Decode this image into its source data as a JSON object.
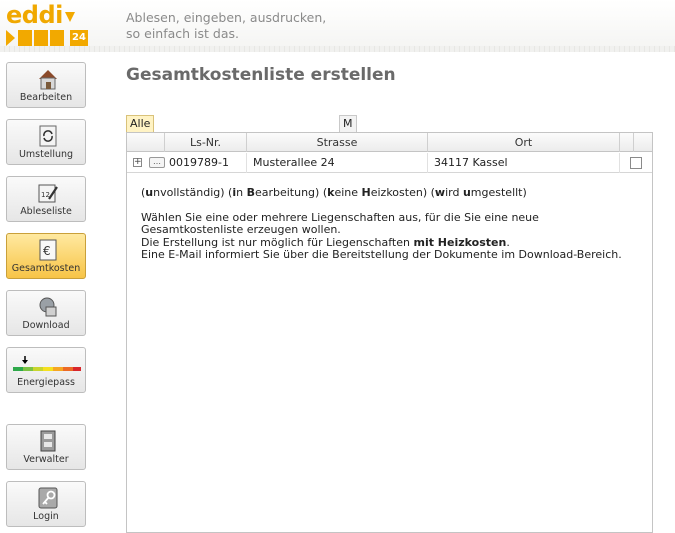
{
  "header": {
    "logo_text": "eddi",
    "logo_number": "24",
    "tagline_line1": "Ablesen, eingeben, ausdrucken,",
    "tagline_line2": "so einfach ist das."
  },
  "sidebar": {
    "items": [
      {
        "label": "Bearbeiten",
        "icon": "house-icon"
      },
      {
        "label": "Umstellung",
        "icon": "refresh-icon"
      },
      {
        "label": "Ableseliste",
        "icon": "calendar-pen-icon"
      },
      {
        "label": "Gesamtkosten",
        "icon": "euro-icon"
      },
      {
        "label": "Download",
        "icon": "download-icon"
      },
      {
        "label": "Energiepass",
        "icon": "energy-scale-icon"
      },
      {
        "label": "Verwalter",
        "icon": "cabinet-icon"
      },
      {
        "label": "Login",
        "icon": "key-icon"
      }
    ],
    "active": "Gesamtkosten"
  },
  "main": {
    "title": "Gesamtkostenliste erstellen",
    "filters": {
      "all": "Alle",
      "m": "M"
    },
    "columns": [
      "Ls-Nr.",
      "Strasse",
      "Ort"
    ],
    "rows": [
      {
        "ls_nr": "0019789-1",
        "strasse": "Musterallee 24",
        "ort": "34117 Kassel"
      }
    ],
    "legend": {
      "p1": "(",
      "b1": "u",
      "t1": "nvollständig)  (",
      "b2": "i",
      "t2": "n ",
      "b3": "B",
      "t3": "earbeitung)  (",
      "b4": "k",
      "t4": "eine ",
      "b5": "H",
      "t5": "eizkosten)  (",
      "b6": "w",
      "t6": "ird ",
      "b7": "u",
      "t7": "mgestellt)"
    },
    "info_line1": "Wählen Sie eine oder mehrere Liegenschaften aus, für die Sie eine neue",
    "info_line2": "Gesamtkostenliste erzeugen wollen.",
    "info_line3_a": "Die Erstellung ist nur möglich für Liegenschaften ",
    "info_line3_b": "mit Heizkosten",
    "info_line3_c": ".",
    "info_line4": "Eine E-Mail informiert Sie über die Bereitstellung der Dokumente im Download-Bereich."
  },
  "colors": {
    "accent": "#f2a900",
    "active_button": "#f7c447",
    "title_gray": "#6a6a6a"
  }
}
